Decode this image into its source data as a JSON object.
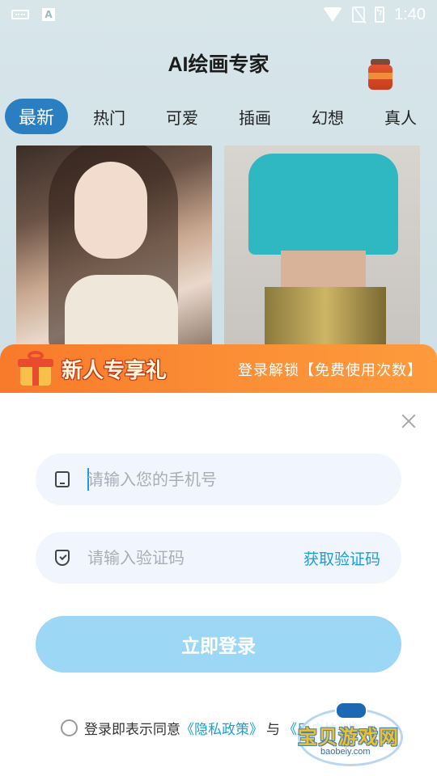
{
  "status_bar": {
    "time": "1:40"
  },
  "app": {
    "title": "AI绘画专家",
    "categories": [
      "最新",
      "热门",
      "可爱",
      "插画",
      "幻想",
      "真人"
    ],
    "active_category": "最新"
  },
  "promo": {
    "title": "新人专享礼",
    "subtitle": "登录解锁【免费使用次数】"
  },
  "login": {
    "phone_placeholder": "请输入您的手机号",
    "code_placeholder": "请输入验证码",
    "get_code_label": "获取验证码",
    "submit_label": "立即登录",
    "agree_prefix": "登录即表示同意",
    "privacy_link": "《隐私政策》",
    "agree_conj": "与",
    "user_link": "《用户协议》"
  },
  "watermark": {
    "text": "宝贝游戏网",
    "url": "baobeiy.com"
  },
  "colors": {
    "tab_active_bg": "#2a7fc3",
    "promo_orange": "#fb8d35",
    "login_button": "#9cd8f5",
    "link_blue": "#1aa0d9"
  }
}
